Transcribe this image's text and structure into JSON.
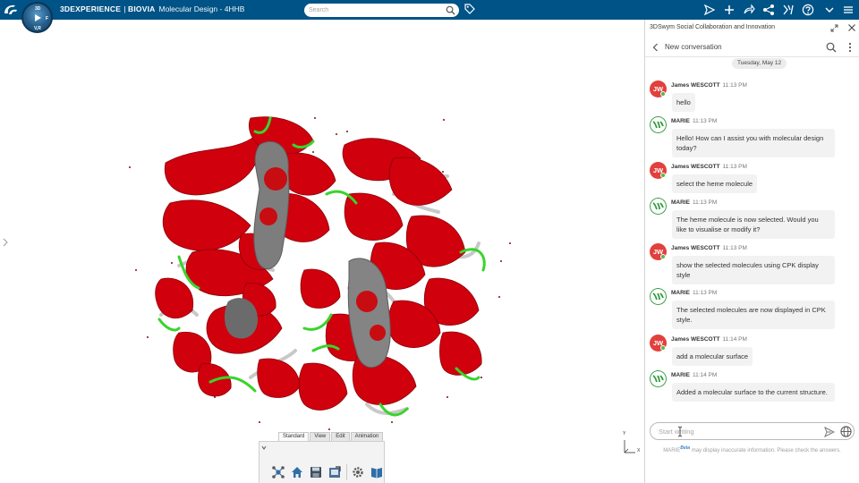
{
  "topbar": {
    "brand_product": "3DEXPERIENCE",
    "brand_separator": " | ",
    "brand_app": "BIOVIA",
    "app_title": "Molecular Design - 4HHB",
    "search_placeholder": "Search",
    "compass_letters": {
      "north": "3D",
      "west": "",
      "east": "F",
      "south": "V,R"
    }
  },
  "toolbar": {
    "tabs": [
      {
        "label": "Standard",
        "active": true
      },
      {
        "label": "View",
        "active": false
      },
      {
        "label": "Edit",
        "active": false
      },
      {
        "label": "Animation",
        "active": false
      }
    ]
  },
  "viewport": {
    "axis_y": "Y",
    "axis_x": "X"
  },
  "panel": {
    "title": "3DSwym Social Collaboration and Innovation",
    "conversation_title": "New conversation",
    "date_divider": "Tuesday, May 12",
    "messages": [
      {
        "sender": "James WESCOTT",
        "initials": "JW",
        "time": "11:13 PM",
        "text": "hello",
        "role": "user"
      },
      {
        "sender": "MARIE",
        "time": "11:13 PM",
        "text": "Hello! How can I assist you with molecular design today?",
        "role": "ai"
      },
      {
        "sender": "James WESCOTT",
        "initials": "JW",
        "time": "11:13 PM",
        "text": "select the heme molecule",
        "role": "user"
      },
      {
        "sender": "MARIE",
        "time": "11:13 PM",
        "text": "The heme molecule is now selected. Would you like to visualise or modify it?",
        "role": "ai"
      },
      {
        "sender": "James WESCOTT",
        "initials": "JW",
        "time": "11:13 PM",
        "text": "show the selected molecules using CPK display style",
        "role": "user"
      },
      {
        "sender": "MARIE",
        "time": "11:13 PM",
        "text": "The selected molecules are now displayed in CPK style.",
        "role": "ai"
      },
      {
        "sender": "James WESCOTT",
        "initials": "JW",
        "time": "11:14 PM",
        "text": "add a molecular surface",
        "role": "user"
      },
      {
        "sender": "MARIE",
        "time": "11:14 PM",
        "text": "Added a molecular surface to the current structure.",
        "role": "ai"
      }
    ],
    "composer_placeholder": "Start writing",
    "disclaimer_name": "MARIE",
    "disclaimer_badge": "Beta",
    "disclaimer_text": " may display inaccurate information. Please check the answers."
  },
  "colors": {
    "topbar": "#005386",
    "ribbon_red": "#d0000d",
    "loop_green": "#39d42c",
    "heme_gray": "#8a8a8a",
    "avatar_red": "#e1403d",
    "ai_green": "#2e9b3b"
  }
}
